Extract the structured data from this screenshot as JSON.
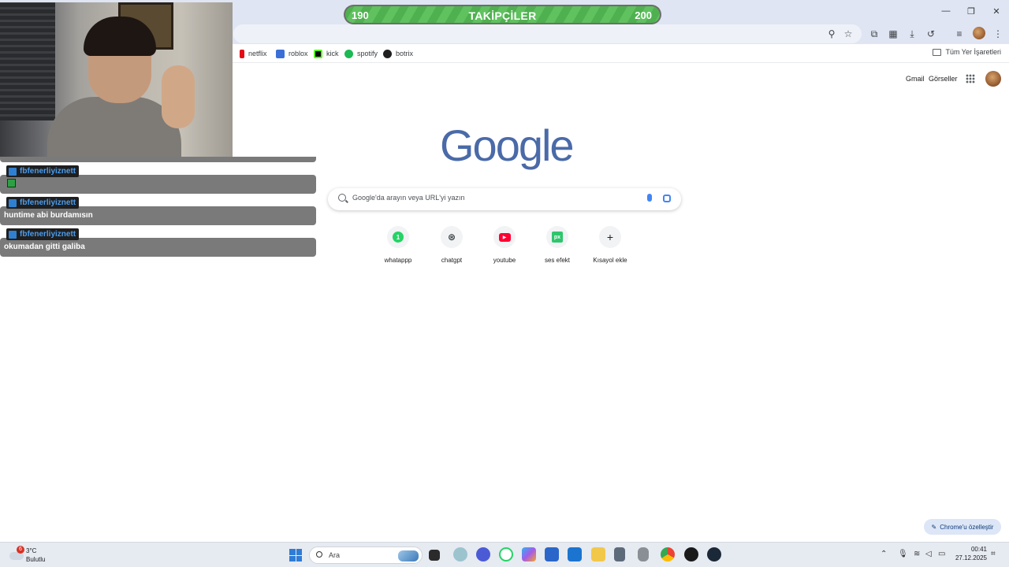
{
  "window_controls": {
    "minimize": "—",
    "restore": "❐",
    "close": "✕"
  },
  "goal": {
    "title": "TAKİPÇİLER",
    "start": "190",
    "end": "200"
  },
  "bookmarks": [
    {
      "label": "netflix",
      "icon": "netflix-icon",
      "color": "#e50914"
    },
    {
      "label": "roblox",
      "icon": "roblox-icon",
      "color": "#3b6fd8"
    },
    {
      "label": "kick",
      "icon": "kick-icon",
      "color": "#53fc18"
    },
    {
      "label": "spotify",
      "icon": "spotify-icon",
      "color": "#1db954"
    },
    {
      "label": "botrix",
      "icon": "botrix-icon",
      "color": "#1f1f1f"
    }
  ],
  "all_bookmarks_label": "Tüm Yer İşaretleri",
  "chat": {
    "messages": [
      {
        "user": "fbfenerliyiznett",
        "text": ""
      },
      {
        "user": "fbfenerliyiznett",
        "text": "huntime abi burdamısın"
      },
      {
        "user": "fbfenerliyiznett",
        "text": "okumadan gitti galiba"
      }
    ]
  },
  "google": {
    "gmail": "Gmail",
    "images": "Görseller",
    "logo": "Google",
    "search_placeholder": "Google'da arayın veya URL'yi yazın",
    "shortcuts": [
      {
        "label": "whatappp",
        "icon": "whatsapp-icon",
        "color": "#25d366",
        "glyph": "1"
      },
      {
        "label": "chatgpt",
        "icon": "chatgpt-icon",
        "color": "#5f6368",
        "glyph": "⊛"
      },
      {
        "label": "youtube",
        "icon": "youtube-icon",
        "color": "#ff0033",
        "glyph": "▶"
      },
      {
        "label": "ses efekt",
        "icon": "pixabay-icon",
        "color": "#2ec66d",
        "glyph": "px"
      },
      {
        "label": "Kısayol ekle",
        "icon": "add-icon",
        "color": "#f1f3f4",
        "glyph": "+"
      }
    ],
    "customize": "Chrome'u özelleştir"
  },
  "taskbar": {
    "weather_badge": "6",
    "weather_temp": "3°C",
    "weather_cond": "Bulutlu",
    "search_placeholder": "Ara",
    "time": "00:41",
    "date": "27.12.2025"
  }
}
